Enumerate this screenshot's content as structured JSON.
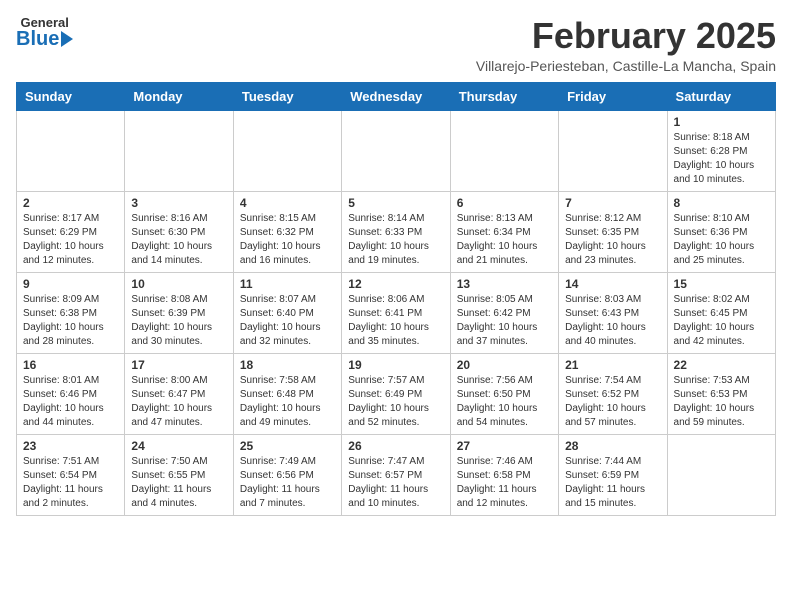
{
  "header": {
    "logo_general": "General",
    "logo_blue": "Blue",
    "month_title": "February 2025",
    "location": "Villarejo-Periesteban, Castille-La Mancha, Spain"
  },
  "days_of_week": [
    "Sunday",
    "Monday",
    "Tuesday",
    "Wednesday",
    "Thursday",
    "Friday",
    "Saturday"
  ],
  "weeks": [
    {
      "days": [
        {
          "number": "",
          "info": ""
        },
        {
          "number": "",
          "info": ""
        },
        {
          "number": "",
          "info": ""
        },
        {
          "number": "",
          "info": ""
        },
        {
          "number": "",
          "info": ""
        },
        {
          "number": "",
          "info": ""
        },
        {
          "number": "1",
          "info": "Sunrise: 8:18 AM\nSunset: 6:28 PM\nDaylight: 10 hours\nand 10 minutes."
        }
      ]
    },
    {
      "days": [
        {
          "number": "2",
          "info": "Sunrise: 8:17 AM\nSunset: 6:29 PM\nDaylight: 10 hours\nand 12 minutes."
        },
        {
          "number": "3",
          "info": "Sunrise: 8:16 AM\nSunset: 6:30 PM\nDaylight: 10 hours\nand 14 minutes."
        },
        {
          "number": "4",
          "info": "Sunrise: 8:15 AM\nSunset: 6:32 PM\nDaylight: 10 hours\nand 16 minutes."
        },
        {
          "number": "5",
          "info": "Sunrise: 8:14 AM\nSunset: 6:33 PM\nDaylight: 10 hours\nand 19 minutes."
        },
        {
          "number": "6",
          "info": "Sunrise: 8:13 AM\nSunset: 6:34 PM\nDaylight: 10 hours\nand 21 minutes."
        },
        {
          "number": "7",
          "info": "Sunrise: 8:12 AM\nSunset: 6:35 PM\nDaylight: 10 hours\nand 23 minutes."
        },
        {
          "number": "8",
          "info": "Sunrise: 8:10 AM\nSunset: 6:36 PM\nDaylight: 10 hours\nand 25 minutes."
        }
      ]
    },
    {
      "days": [
        {
          "number": "9",
          "info": "Sunrise: 8:09 AM\nSunset: 6:38 PM\nDaylight: 10 hours\nand 28 minutes."
        },
        {
          "number": "10",
          "info": "Sunrise: 8:08 AM\nSunset: 6:39 PM\nDaylight: 10 hours\nand 30 minutes."
        },
        {
          "number": "11",
          "info": "Sunrise: 8:07 AM\nSunset: 6:40 PM\nDaylight: 10 hours\nand 32 minutes."
        },
        {
          "number": "12",
          "info": "Sunrise: 8:06 AM\nSunset: 6:41 PM\nDaylight: 10 hours\nand 35 minutes."
        },
        {
          "number": "13",
          "info": "Sunrise: 8:05 AM\nSunset: 6:42 PM\nDaylight: 10 hours\nand 37 minutes."
        },
        {
          "number": "14",
          "info": "Sunrise: 8:03 AM\nSunset: 6:43 PM\nDaylight: 10 hours\nand 40 minutes."
        },
        {
          "number": "15",
          "info": "Sunrise: 8:02 AM\nSunset: 6:45 PM\nDaylight: 10 hours\nand 42 minutes."
        }
      ]
    },
    {
      "days": [
        {
          "number": "16",
          "info": "Sunrise: 8:01 AM\nSunset: 6:46 PM\nDaylight: 10 hours\nand 44 minutes."
        },
        {
          "number": "17",
          "info": "Sunrise: 8:00 AM\nSunset: 6:47 PM\nDaylight: 10 hours\nand 47 minutes."
        },
        {
          "number": "18",
          "info": "Sunrise: 7:58 AM\nSunset: 6:48 PM\nDaylight: 10 hours\nand 49 minutes."
        },
        {
          "number": "19",
          "info": "Sunrise: 7:57 AM\nSunset: 6:49 PM\nDaylight: 10 hours\nand 52 minutes."
        },
        {
          "number": "20",
          "info": "Sunrise: 7:56 AM\nSunset: 6:50 PM\nDaylight: 10 hours\nand 54 minutes."
        },
        {
          "number": "21",
          "info": "Sunrise: 7:54 AM\nSunset: 6:52 PM\nDaylight: 10 hours\nand 57 minutes."
        },
        {
          "number": "22",
          "info": "Sunrise: 7:53 AM\nSunset: 6:53 PM\nDaylight: 10 hours\nand 59 minutes."
        }
      ]
    },
    {
      "days": [
        {
          "number": "23",
          "info": "Sunrise: 7:51 AM\nSunset: 6:54 PM\nDaylight: 11 hours\nand 2 minutes."
        },
        {
          "number": "24",
          "info": "Sunrise: 7:50 AM\nSunset: 6:55 PM\nDaylight: 11 hours\nand 4 minutes."
        },
        {
          "number": "25",
          "info": "Sunrise: 7:49 AM\nSunset: 6:56 PM\nDaylight: 11 hours\nand 7 minutes."
        },
        {
          "number": "26",
          "info": "Sunrise: 7:47 AM\nSunset: 6:57 PM\nDaylight: 11 hours\nand 10 minutes."
        },
        {
          "number": "27",
          "info": "Sunrise: 7:46 AM\nSunset: 6:58 PM\nDaylight: 11 hours\nand 12 minutes."
        },
        {
          "number": "28",
          "info": "Sunrise: 7:44 AM\nSunset: 6:59 PM\nDaylight: 11 hours\nand 15 minutes."
        },
        {
          "number": "",
          "info": ""
        }
      ]
    }
  ]
}
